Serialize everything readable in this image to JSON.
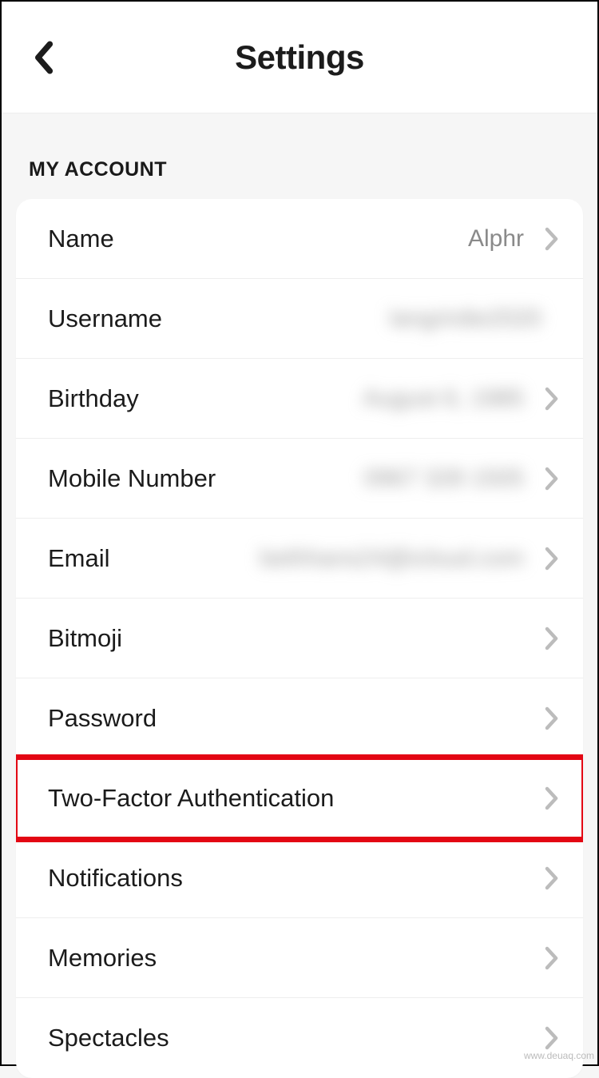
{
  "header": {
    "title": "Settings"
  },
  "section": {
    "title": "MY ACCOUNT"
  },
  "rows": {
    "name": {
      "label": "Name",
      "value": "Alphr",
      "blurred": false,
      "chevron": true
    },
    "username": {
      "label": "Username",
      "value": "langrirdie2020",
      "blurred": true,
      "chevron": false
    },
    "birthday": {
      "label": "Birthday",
      "value": "August 6, 1985",
      "blurred": true,
      "chevron": true
    },
    "mobile": {
      "label": "Mobile Number",
      "value": "0967 328 1505",
      "blurred": true,
      "chevron": true
    },
    "email": {
      "label": "Email",
      "value": "bethhans24@icloud.com",
      "blurred": true,
      "chevron": true
    },
    "bitmoji": {
      "label": "Bitmoji",
      "value": "",
      "blurred": false,
      "chevron": true
    },
    "password": {
      "label": "Password",
      "value": "",
      "blurred": false,
      "chevron": true
    },
    "twofactor": {
      "label": "Two-Factor Authentication",
      "value": "",
      "blurred": false,
      "chevron": true
    },
    "notifications": {
      "label": "Notifications",
      "value": "",
      "blurred": false,
      "chevron": true
    },
    "memories": {
      "label": "Memories",
      "value": "",
      "blurred": false,
      "chevron": true
    },
    "spectacles": {
      "label": "Spectacles",
      "value": "",
      "blurred": false,
      "chevron": true
    }
  },
  "highlight_row": "twofactor",
  "watermark": "www.deuaq.com",
  "colors": {
    "highlight": "#e30613",
    "text": "#1b1b1b",
    "secondary": "#8a8a8a",
    "bg": "#f6f6f6"
  }
}
